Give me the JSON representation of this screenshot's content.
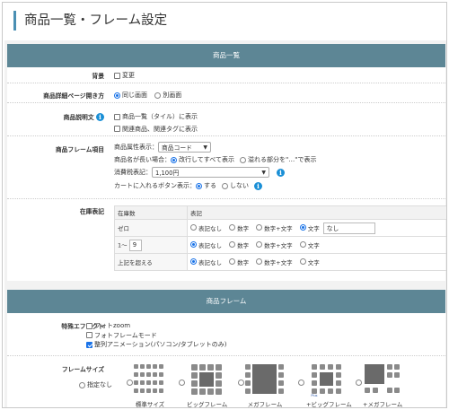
{
  "page": {
    "title": "商品一覧・フレーム設定"
  },
  "list_section": {
    "header": "商品一覧",
    "rows": {
      "cover": {
        "label": "背景",
        "option": "変更"
      },
      "open": {
        "label": "商品詳細ページ開き方",
        "options": [
          "同じ画面",
          "別画面"
        ],
        "selected": "同じ画面"
      },
      "desc": {
        "label": "商品説明文",
        "info": "i",
        "options": [
          "商品一覧（タイル）に表示",
          "関連商品、関連タグに表示"
        ]
      },
      "frame": {
        "label": "商品フレーム項目",
        "attr_label": "商品属性表示：",
        "attr_value": "商品コード",
        "long_label": "商品名が長い場合：",
        "long_options": [
          "改行してすべて表示",
          "溢れる部分を\"…\"で表示"
        ],
        "long_selected": "改行してすべて表示",
        "tax_label": "消費税表記：",
        "tax_value": "1,100円",
        "cart_label": "カートに入れるボタン表示：",
        "cart_options": [
          "する",
          "しない"
        ],
        "cart_selected": "する",
        "info": "i"
      },
      "stock": {
        "label": "在庫表記",
        "headers": [
          "在庫数",
          "表記"
        ],
        "rows": [
          {
            "name": "ゼロ",
            "options": [
              "表記なし",
              "数字",
              "数字+文字",
              "文字"
            ],
            "selected": "文字",
            "text": "なし"
          },
          {
            "name": "1〜",
            "value": "9",
            "options": [
              "表記なし",
              "数字",
              "数字+文字",
              "文字"
            ],
            "selected": "表記なし"
          },
          {
            "name": "上記を超える",
            "options": [
              "表記なし",
              "数字",
              "数字+文字",
              "文字"
            ],
            "selected": "表記なし"
          }
        ]
      }
    }
  },
  "frame_section": {
    "header": "商品フレーム",
    "effects": {
      "label": "特殊エフェクト",
      "options": [
        {
          "text": "フォトzoom",
          "checked": false
        },
        {
          "text": "フォトフレームモード",
          "checked": false
        },
        {
          "text": "整列アニメーション(パソコン/タブレットのみ)",
          "checked": true
        }
      ]
    },
    "sizes": {
      "label": "フレームサイズ",
      "none_label": "指定なし",
      "items": [
        "標準サイズ",
        "ビッグフレーム",
        "メガフレーム",
        "+ビッグフレーム",
        "+メガフレーム"
      ]
    }
  }
}
